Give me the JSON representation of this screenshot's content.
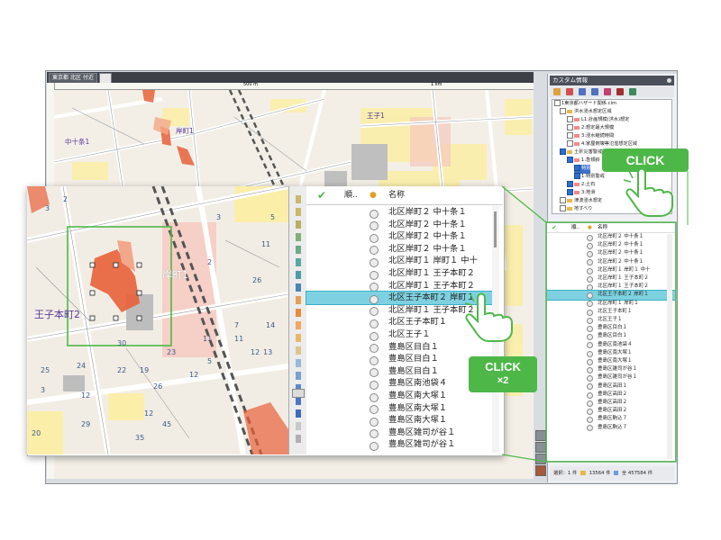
{
  "window": {
    "tab1": "東京都 北区 付近",
    "ruler_labels": [
      "500 m",
      "1 km"
    ]
  },
  "map_labels": {
    "oji_1": "王子1",
    "naka_jujo_1": "中十条1",
    "kishimachi_1": "岸町1",
    "kishimachi_1_zoom": "岸町1",
    "oji_honcho_2": "王子本町2"
  },
  "block_numbers": [
    "3",
    "1",
    "2",
    "26",
    "7",
    "11",
    "14",
    "13",
    "12",
    "11",
    "5",
    "1",
    "12",
    "3",
    "12",
    "12",
    "20",
    "19",
    "22",
    "23",
    "25",
    "24",
    "26",
    "30",
    "29",
    "35",
    "45",
    "5",
    "2",
    "3"
  ],
  "side_panel": {
    "title": "カスタム情報",
    "tree": [
      {
        "label": "1東京都ハザード関係.cim",
        "indent": 0,
        "checked": false,
        "folder": false
      },
      {
        "label": "洪水浸水想定区域",
        "indent": 1,
        "checked": false,
        "folder": true
      },
      {
        "label": "L1:計画規模(洪水)想定",
        "indent": 2,
        "checked": false,
        "folder": false
      },
      {
        "label": "2:想定最大規模",
        "indent": 2,
        "checked": false,
        "folder": false
      },
      {
        "label": "3:浸水継続時間",
        "indent": 2,
        "checked": false,
        "folder": false
      },
      {
        "label": "4:家屋倒壊等氾濫想定区域",
        "indent": 2,
        "checked": false,
        "folder": false
      },
      {
        "label": "土砂災害警戒区域",
        "indent": 1,
        "checked": true,
        "folder": true
      },
      {
        "label": "1:急傾斜",
        "indent": 2,
        "checked": true,
        "folder": false
      },
      {
        "label": "特別",
        "indent": 3,
        "checked": true,
        "folder": false
      },
      {
        "label": "1:特別警戒",
        "indent": 3,
        "checked": true,
        "folder": false
      },
      {
        "label": "2:土石",
        "indent": 2,
        "checked": true,
        "folder": false
      },
      {
        "label": "3:地滑",
        "indent": 2,
        "checked": true,
        "folder": false
      },
      {
        "label": "津波浸水想定",
        "indent": 1,
        "checked": false,
        "folder": true
      },
      {
        "label": "地すべり",
        "indent": 1,
        "checked": false,
        "folder": true
      }
    ],
    "list_header": {
      "order": "順..",
      "name": "名称"
    },
    "list_rows": [
      "北区岸町２ 中十条１",
      "北区岸町２ 中十条１",
      "北区岸町２ 中十条１",
      "北区岸町２ 中十条１",
      "北区岸町１ 岸町１ 中十",
      "北区岸町１ 王子本町２",
      "北区岸町１ 王子本町２",
      "北区王子本町２ 岸町１",
      "北区岸町１ 岸町１",
      "北区王子本町１",
      "北区王子１",
      "豊島区目白１",
      "豊島区目白１",
      "豊島区南池袋４",
      "豊島区南大塚１",
      "豊島区南大塚１",
      "豊島区雑司が谷１",
      "豊島区雑司が谷１",
      "豊島区高田１",
      "豊島区高田２",
      "豊島区高田２",
      "豊島区高田２",
      "豊島区駒込７",
      "豊島区駒込７"
    ],
    "selected_index": 7,
    "status": {
      "selected": "選択：1 件",
      "count": "13564 件",
      "total": "全 457584 件"
    }
  },
  "zoom_list": {
    "header_order": "順..",
    "header_name": "名称",
    "rows": [
      "北区岸町２ 中十条１",
      "北区岸町２ 中十条１",
      "北区岸町２ 中十条１",
      "北区岸町２ 中十条１",
      "北区岸町１ 岸町１ 中十",
      "北区岸町１ 王子本町２",
      "北区岸町１ 王子本町２",
      "北区王子本町２ 岸町１",
      "北区岸町１ 王子本町２",
      "北区王子本町１",
      "北区王子１",
      "豊島区目白１",
      "豊島区目白１",
      "豊島区目白１",
      "豊島区南池袋４",
      "豊島区南大塚１",
      "豊島区南大塚１",
      "豊島区南大塚１",
      "豊島区雑司が谷１",
      "豊島区雑司が谷１"
    ],
    "selected_index": 7
  },
  "callouts": {
    "click_top": "CLICK",
    "click_double": "CLICK",
    "click_double_sub": "×2"
  },
  "colors": {
    "accent_green": "#4db848",
    "selection": "#7ed1e0",
    "hazard_orange": "#e8603a",
    "hazard_light": "#f3a78a",
    "yellow_zone": "#fbeea8"
  }
}
